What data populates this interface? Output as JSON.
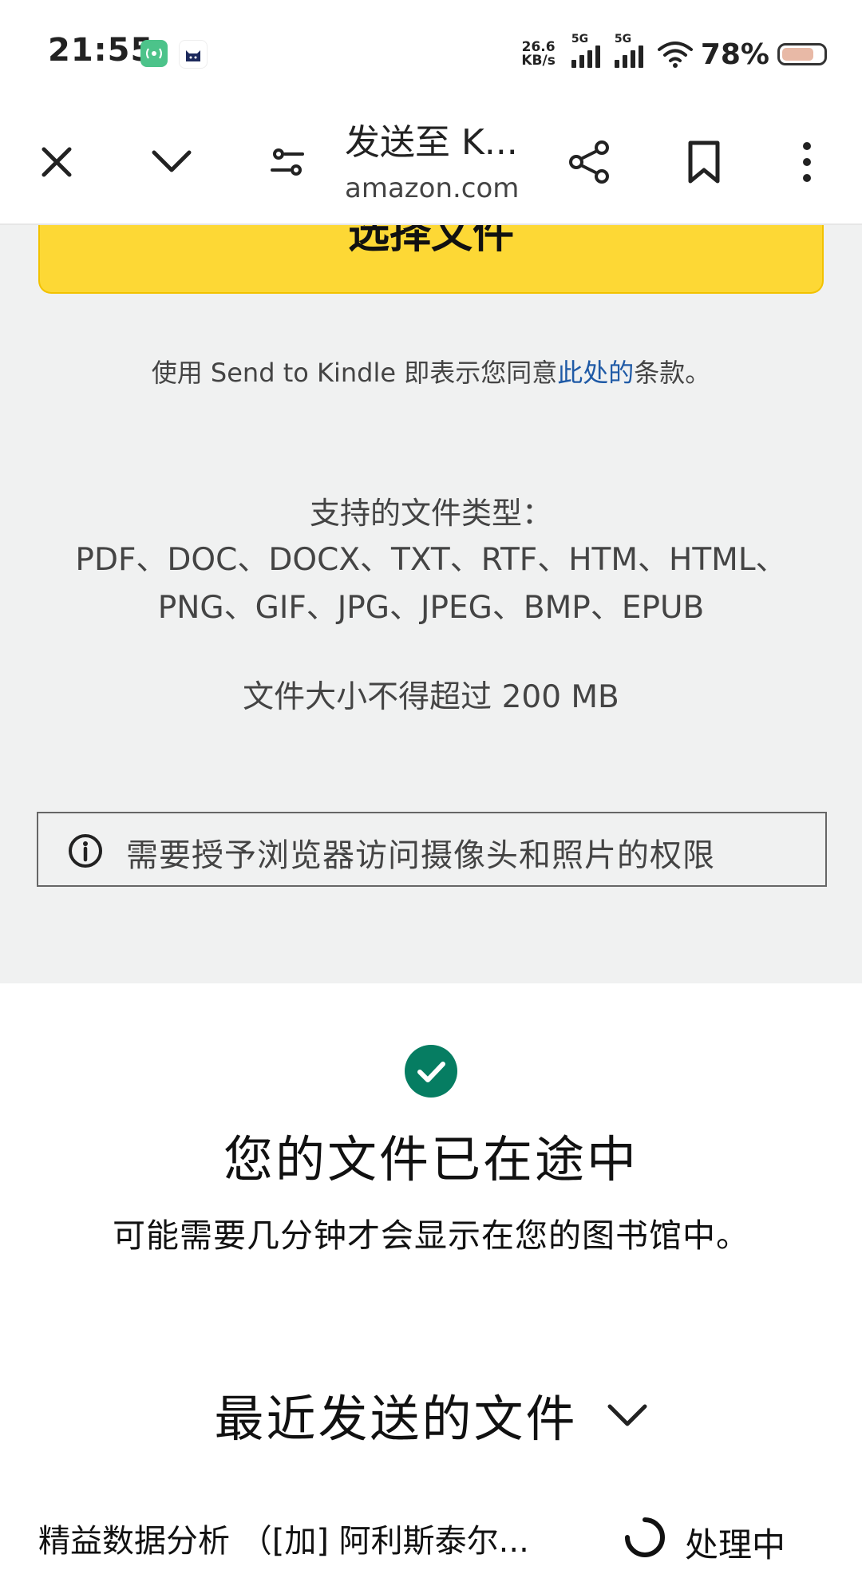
{
  "status_bar": {
    "time": "21:55",
    "net_speed_value": "26.6",
    "net_speed_unit": "KB/s",
    "signal1_label": "5G",
    "signal2_label": "5G",
    "battery_percent": "78%",
    "battery_level": 0.78,
    "icons": [
      "radio-app-icon",
      "cat-app-icon",
      "wifi-icon",
      "battery-icon"
    ]
  },
  "browser": {
    "page_title": "发送至 K...",
    "domain": "amazon.com",
    "icons": [
      "close-icon",
      "chevron-down-icon",
      "tune-icon",
      "share-icon",
      "bookmark-icon",
      "more-vert-icon"
    ]
  },
  "upload": {
    "choose_file_label": "选择文件",
    "terms_prefix": "使用 Send to Kindle 即表示您同意",
    "terms_link": "此处的",
    "terms_suffix": "条款。",
    "file_types_title": "支持的文件类型：",
    "file_types_line1": "PDF、DOC、DOCX、TXT、RTF、HTM、HTML、",
    "file_types_line2": "PNG、GIF、JPG、JPEG、BMP、EPUB",
    "size_limit": "文件大小不得超过 200 MB",
    "permission_text": "需要授予浏览器访问摄像头和照片的权限"
  },
  "success": {
    "title": "您的文件已在途中",
    "subtitle": "可能需要几分钟才会显示在您的图书馆中。",
    "recent_title": "最近发送的文件",
    "files": [
      {
        "name": "精益数据分析 （[加] 阿利斯泰尔...",
        "status": "处理中"
      }
    ]
  },
  "colors": {
    "accent_yellow": "#fdd835",
    "link_blue": "#1f5aa6",
    "success_green": "#067d62",
    "section_gray": "#f0f1f1"
  }
}
